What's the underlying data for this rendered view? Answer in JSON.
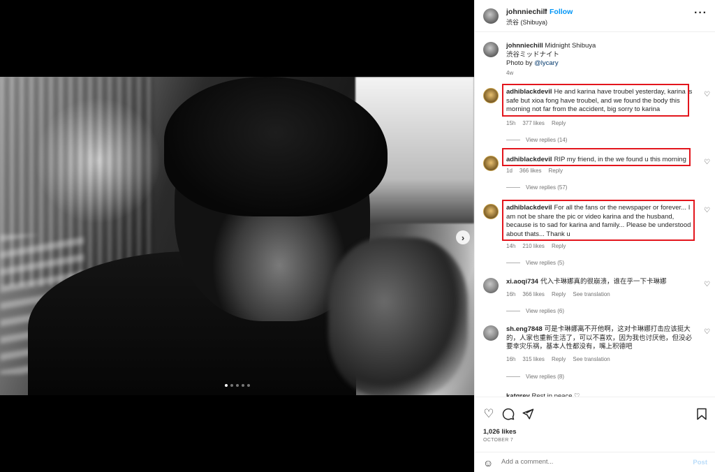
{
  "post": {
    "username": "johnniechill",
    "separator": "•",
    "follow_label": "Follow",
    "location": "渋谷 (Shibuya)",
    "more_icon": "more-horizontal-icon"
  },
  "caption": {
    "username": "johnniechill",
    "line1": "Midnight Shibuya",
    "line2": "渋谷ミッドナイト",
    "photo_by_prefix": "Photo by ",
    "photo_by_mention": "@lycary",
    "age": "4w"
  },
  "comments": [
    {
      "username": "adhiblackdevil",
      "text": "He and karina have troubel yesterday, karina is safe but xioa fong have troubel, and we found the body this morning not far from the accident, big sorry to karina",
      "age": "15h",
      "likes": "377 likes",
      "reply": "Reply",
      "view_replies": "View replies (14)"
    },
    {
      "username": "adhiblackdevil",
      "text": "RIP my friend, in the we found u this morning",
      "age": "1d",
      "likes": "366 likes",
      "reply": "Reply",
      "view_replies": "View replies (57)"
    },
    {
      "username": "adhiblackdevil",
      "text": "For all the fans or the newspaper or forever... I am not be share the pic or video karina and the husband, because is to sad for karina and family... Please be understood about thats... Thank u",
      "age": "14h",
      "likes": "210 likes",
      "reply": "Reply",
      "view_replies": "View replies (5)"
    },
    {
      "username": "xi.aoqi734",
      "text": "代入卡琳娜真的很崩溃，谁在乎一下卡琳娜",
      "age": "16h",
      "likes": "366 likes",
      "reply": "Reply",
      "see_translation": "See translation",
      "view_replies": "View replies (6)"
    },
    {
      "username": "sh.eng7848",
      "text": "可是卡琳娜离不开他啊，这对卡琳娜打击应该挺大的，人家也重新生活了，可以不喜欢，因为我也讨厌他，但没必要幸灾乐祸，基本人性都没有，嘴上积德吧",
      "age": "16h",
      "likes": "315 likes",
      "reply": "Reply",
      "see_translation": "See translation",
      "view_replies": "View replies (8)"
    }
  ],
  "peek_comment": {
    "username": "katgrey",
    "text": "Rest in peace ♡"
  },
  "actions": {
    "like_icon": "heart-icon",
    "comment_icon": "comment-icon",
    "share_icon": "share-icon",
    "save_icon": "bookmark-icon",
    "likes": "1,026 likes",
    "date": "OCTOBER 7"
  },
  "add_comment": {
    "placeholder": "Add a comment...",
    "post_label": "Post",
    "emoji_icon": "emoji-icon"
  },
  "carousel": {
    "slide_count": 5,
    "active_index": 0,
    "next_icon": "chevron-right-icon"
  },
  "colors": {
    "accent": "#0095f6",
    "highlight_box": "#e3151c",
    "meta_text": "#737373"
  }
}
